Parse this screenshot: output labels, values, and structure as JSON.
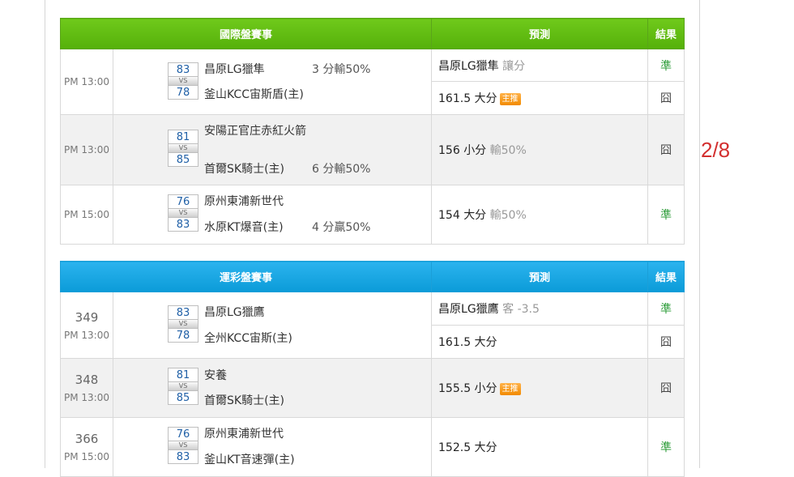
{
  "side_page": "2/8",
  "tables": [
    {
      "header": {
        "match": "國際盤賽事",
        "prediction": "預測",
        "result": "結果"
      },
      "games": [
        {
          "time": "PM 13:00",
          "score_away": "83",
          "score_home": "78",
          "team_away": "昌原LG獵隼",
          "team_home": "釜山KCC宙斯盾(主)",
          "handicap": "3 分輸50%",
          "predictions": [
            {
              "main": "昌原LG獵隼",
              "sub": "讓分",
              "result": "準"
            },
            {
              "main": "161.5 大分",
              "badge": "主推",
              "result": "囧"
            }
          ]
        },
        {
          "time": "PM 13:00",
          "score_away": "81",
          "score_home": "85",
          "team_away": "安陽正官庄赤紅火箭",
          "team_home": "首爾SK騎士(主)",
          "handicap": "6 分輸50%",
          "predictions": [
            {
              "main": "156 小分",
              "sub": "輸50%",
              "result": "囧"
            }
          ]
        },
        {
          "time": "PM 15:00",
          "score_away": "76",
          "score_home": "83",
          "team_away": "原州東浦新世代",
          "team_home": "水原KT爆音(主)",
          "handicap": "4 分贏50%",
          "predictions": [
            {
              "main": "154 大分",
              "sub": "輸50%",
              "result": "準"
            }
          ]
        }
      ]
    },
    {
      "header": {
        "match": "運彩盤賽事",
        "prediction": "預測",
        "result": "結果"
      },
      "games": [
        {
          "number": "349",
          "time": "PM 13:00",
          "score_away": "83",
          "score_home": "78",
          "team_away": "昌原LG獵鷹",
          "team_home": "全州KCC宙斯(主)",
          "predictions": [
            {
              "main": "昌原LG獵鷹",
              "sub": "客 -3.5",
              "result": "準"
            },
            {
              "main": "161.5 大分",
              "result": "囧"
            }
          ]
        },
        {
          "number": "348",
          "time": "PM 13:00",
          "score_away": "81",
          "score_home": "85",
          "team_away": "安養",
          "team_home": "首爾SK騎士(主)",
          "predictions": [
            {
              "main": "155.5 小分",
              "badge": "主推",
              "result": "囧"
            }
          ]
        },
        {
          "number": "366",
          "time": "PM 15:00",
          "score_away": "76",
          "score_home": "83",
          "team_away": "原州東浦新世代",
          "team_home": "釜山KT音速彈(主)",
          "predictions": [
            {
              "main": "152.5 大分",
              "result": "準"
            }
          ]
        }
      ]
    }
  ],
  "colors": {
    "green_header": "#5cb811",
    "blue_header": "#16a4e0",
    "hit": "#2e9d3a",
    "miss": "#444444",
    "badge": "#f59a12",
    "page_indicator": "#d32f2f"
  }
}
